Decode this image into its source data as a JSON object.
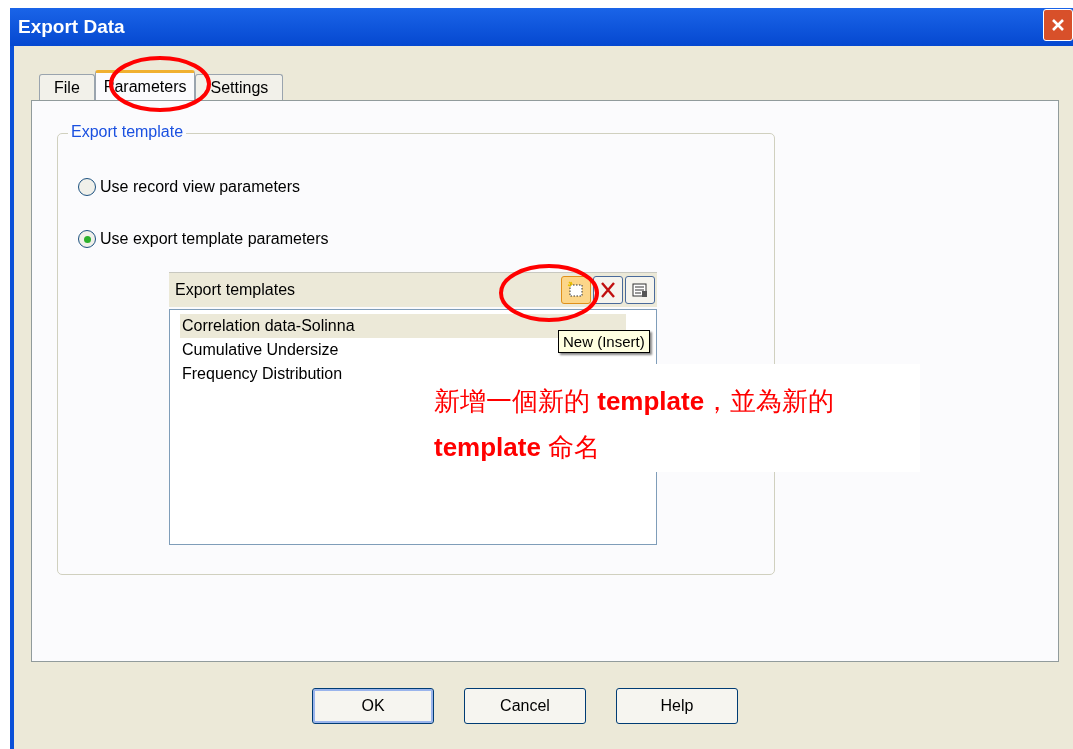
{
  "window": {
    "title": "Export Data"
  },
  "tabs": [
    {
      "label": "File",
      "selected": false
    },
    {
      "label": "Parameters",
      "selected": true
    },
    {
      "label": "Settings",
      "selected": false
    }
  ],
  "group": {
    "title": "Export template",
    "options": [
      {
        "label": "Use record view parameters",
        "selected": false
      },
      {
        "label": "Use export template parameters",
        "selected": true
      }
    ]
  },
  "templates": {
    "title": "Export templates",
    "items": [
      {
        "label": "Correlation data-Solinna",
        "selected": true
      },
      {
        "label": "Cumulative Undersize",
        "selected": false
      },
      {
        "label": "Frequency Distribution",
        "selected": false
      }
    ]
  },
  "tooltip": "New (Insert)",
  "annotation": "新增一個新的 **template**，並為新的 **template** 命名",
  "buttons": [
    "OK",
    "Cancel",
    "Help"
  ]
}
